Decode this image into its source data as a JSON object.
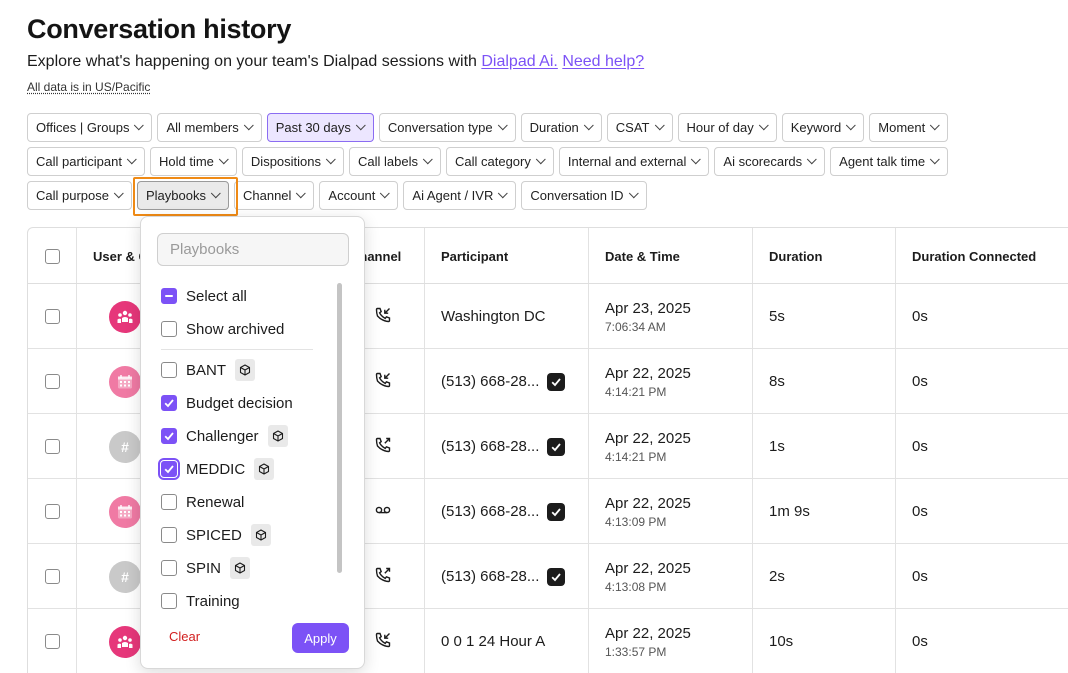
{
  "header": {
    "title": "Conversation history",
    "subtitle_text": "Explore what's happening on your team's Dialpad sessions with ",
    "link_ai": "Dialpad Ai.",
    "link_help": "Need help?",
    "timezone_note": "All data is in US/Pacific"
  },
  "filters": {
    "row1": [
      "Offices | Groups",
      "All members",
      "Past 30 days",
      "Conversation type",
      "Duration",
      "CSAT",
      "Hour of day",
      "Keyword",
      "Moment"
    ],
    "row2": [
      "Call participant",
      "Hold time",
      "Dispositions",
      "Call labels",
      "Call category",
      "Internal and external",
      "Ai scorecards",
      "Agent talk time"
    ],
    "row3": [
      "Call purpose",
      "Playbooks",
      "Channel",
      "Account",
      "Ai Agent / IVR",
      "Conversation ID"
    ],
    "active": "Past 30 days",
    "open": "Playbooks"
  },
  "table": {
    "columns": {
      "user": "User & G",
      "channel": "Channel",
      "participant": "Participant",
      "datetime": "Date & Time",
      "duration": "Duration",
      "duration_connected": "Duration Connected"
    },
    "rows": [
      {
        "avatar": "group-avatar",
        "channel_icon": "incoming-call-icon",
        "participant": "Washington DC",
        "verified": false,
        "date": "Apr 23, 2025",
        "time": "7:06:34 AM",
        "duration": "5s",
        "connected": "0s"
      },
      {
        "avatar": "calendar-avatar",
        "channel_icon": "incoming-call-icon",
        "participant": "(513) 668-28...",
        "verified": true,
        "date": "Apr 22, 2025",
        "time": "4:14:21 PM",
        "duration": "8s",
        "connected": "0s"
      },
      {
        "avatar": "hash-avatar",
        "avatar_text": "#",
        "channel_icon": "outgoing-call-icon",
        "participant": "(513) 668-28...",
        "verified": true,
        "date": "Apr 22, 2025",
        "time": "4:14:21 PM",
        "duration": "1s",
        "connected": "0s"
      },
      {
        "avatar": "calendar-avatar",
        "channel_icon": "voicemail-icon",
        "participant": "(513) 668-28...",
        "verified": true,
        "date": "Apr 22, 2025",
        "time": "4:13:09 PM",
        "duration": "1m 9s",
        "connected": "0s"
      },
      {
        "avatar": "hash-avatar",
        "avatar_text": "#",
        "channel_icon": "outgoing-call-icon",
        "participant": "(513) 668-28...",
        "verified": true,
        "date": "Apr 22, 2025",
        "time": "4:13:08 PM",
        "duration": "2s",
        "connected": "0s"
      },
      {
        "avatar": "group-avatar",
        "channel_icon": "incoming-call-icon",
        "participant": "0 0 1 24 Hour A",
        "verified": false,
        "date": "Apr 22, 2025",
        "time": "1:33:57 PM",
        "duration": "10s",
        "connected": "0s"
      }
    ]
  },
  "playbooks_dropdown": {
    "search_placeholder": "Playbooks",
    "select_all": "Select all",
    "show_archived": "Show archived",
    "options": [
      {
        "label": "BANT",
        "checked": false,
        "tag": true
      },
      {
        "label": "Budget decision",
        "checked": true,
        "tag": false
      },
      {
        "label": "Challenger",
        "checked": true,
        "tag": true
      },
      {
        "label": "MEDDIC",
        "checked": true,
        "tag": true,
        "focused": true
      },
      {
        "label": "Renewal",
        "checked": false,
        "tag": false
      },
      {
        "label": "SPICED",
        "checked": false,
        "tag": true
      },
      {
        "label": "SPIN",
        "checked": false,
        "tag": true
      },
      {
        "label": "Training",
        "checked": false,
        "tag": false
      }
    ],
    "clear_label": "Clear",
    "apply_label": "Apply"
  },
  "colors": {
    "accent": "#7c52f6",
    "clear": "#d21f1f",
    "focus_ring": "#ef8a15",
    "avatar_pink": "#e6377a",
    "avatar_calendar": "#f07aa4",
    "avatar_gray": "#c9c9c9"
  }
}
